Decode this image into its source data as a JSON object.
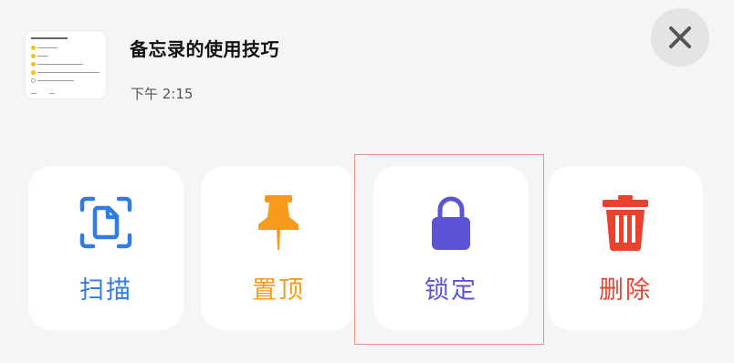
{
  "note": {
    "title": "备忘录的使用技巧",
    "time": "下午 2:15"
  },
  "close": {
    "icon": "close-icon"
  },
  "actions": [
    {
      "label": "扫描",
      "icon": "scan-document-icon",
      "color": "#2f7de1"
    },
    {
      "label": "置顶",
      "icon": "pin-icon",
      "color": "#f79a1e"
    },
    {
      "label": "锁定",
      "icon": "lock-icon",
      "color": "#5b55d6"
    },
    {
      "label": "删除",
      "icon": "trash-icon",
      "color": "#e8432e"
    }
  ],
  "colors": {
    "background": "#f5f5f5",
    "card": "#ffffff",
    "highlight": "#e8917f"
  }
}
